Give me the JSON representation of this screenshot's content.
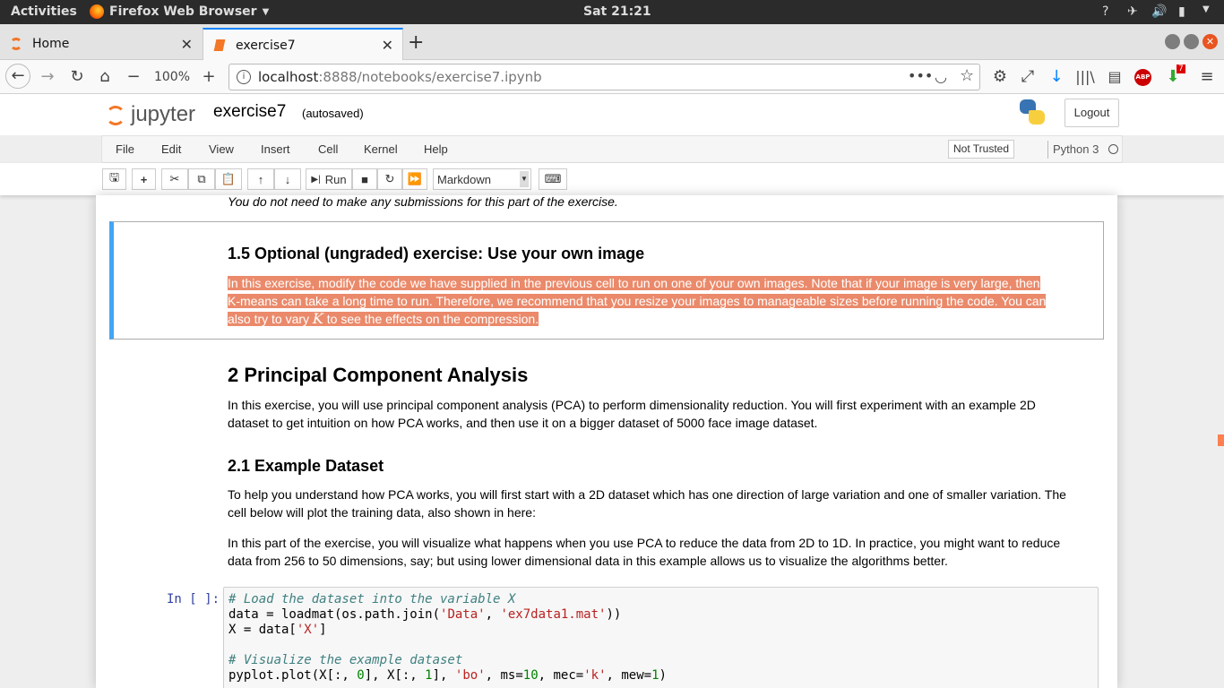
{
  "gnome": {
    "activities": "Activities",
    "app": "Firefox Web Browser",
    "clock": "Sat 21:21"
  },
  "tabs": [
    {
      "label": "Home",
      "active": false
    },
    {
      "label": "exercise7",
      "active": true
    }
  ],
  "nav": {
    "zoom": "100%",
    "url_host": "localhost",
    "url_rest": ":8888/notebooks/exercise7.ipynb",
    "abp": "ABP",
    "badge": "7"
  },
  "jupyter": {
    "logo": "jupyter",
    "title": "exercise7",
    "status": "(autosaved)",
    "logout": "Logout"
  },
  "menu": [
    "File",
    "Edit",
    "View",
    "Insert",
    "Cell",
    "Kernel",
    "Help"
  ],
  "trust": "Not Trusted",
  "kernel": "Python 3",
  "toolbar": {
    "run": "Run",
    "cell_type": "Markdown"
  },
  "notebook": {
    "submission_note": "You do not need to make any submissions for this part of the exercise.",
    "h15": "1.5 Optional (ungraded) exercise: Use your own image",
    "p15_line1": "In this exercise, modify the code we have supplied in the previous cell to run on one of your own images. Note that if your image is very large, then",
    "p15_line2": "K-means can take a long time to run. Therefore, we recommend that you resize your images to manageable sizes before running the code. You can",
    "p15_line3a": "also try to vary ",
    "p15_K": "K",
    "p15_line3b": " to see the effects on the compression.",
    "h2": "2 Principal Component Analysis",
    "p2_line1": "In this exercise, you will use principal component analysis (PCA) to perform dimensionality reduction. You will first experiment with an example 2D",
    "p2_line2": "dataset to get intuition on how PCA works, and then use it on a bigger dataset of 5000 face image dataset.",
    "h21": "2.1 Example Dataset",
    "p21a_line1": "To help you understand how PCA works, you will first start with a 2D dataset which has one direction of large variation and one of smaller variation. The",
    "p21a_line2": "cell below will plot the training data, also shown in here:",
    "p21b_line1": "In this part of the exercise, you will visualize what happens when you use PCA to reduce the data from 2D to 1D. In practice, you might want to reduce",
    "p21b_line2": "data from 256 to 50 dimensions, say; but using lower dimensional data in this example allows us to visualize the algorithms better.",
    "prompt": "In [ ]:",
    "code": {
      "c1": "# Load the dataset into the variable X",
      "l2a": "data = loadmat(os.path.join(",
      "l2s1": "'Data'",
      "l2b": ", ",
      "l2s2": "'ex7data1.mat'",
      "l2c": "))",
      "l3a": "X = data[",
      "l3s": "'X'",
      "l3b": "]",
      "c2": "#  Visualize the example dataset",
      "l5a": "pyplot.plot(X[:, ",
      "l5n1": "0",
      "l5b": "], X[:, ",
      "l5n2": "1",
      "l5c": "], ",
      "l5s1": "'bo'",
      "l5d": ", ms=",
      "l5n3": "10",
      "l5e": ", mec=",
      "l5s2": "'k'",
      "l5f": ", mew=",
      "l5n4": "1",
      "l5g": ")"
    }
  }
}
